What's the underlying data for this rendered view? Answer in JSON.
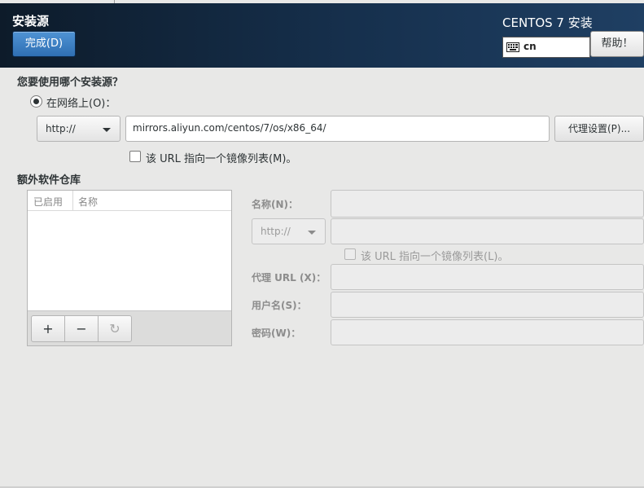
{
  "header": {
    "page_title": "安装源",
    "done_label": "完成(D)",
    "product_title": "CENTOS 7 安装",
    "keyboard_layout": "cn",
    "help_label": "帮助！"
  },
  "source": {
    "question": "您要使用哪个安装源？",
    "network_radio_label": "在网络上(O)：",
    "network_selected": true,
    "protocol": "http://",
    "url": "mirrors.aliyun.com/centos/7/os/x86_64/",
    "proxy_button": "代理设置(P)...",
    "mirror_checkbox_label": "该 URL 指向一个镜像列表(M)。",
    "mirror_checked": false
  },
  "repos": {
    "title": "额外软件仓库",
    "columns": [
      "已启用",
      "名称"
    ],
    "rows": [],
    "add_label": "+",
    "remove_label": "−",
    "refresh_label": "↻"
  },
  "repo_form": {
    "name_label": "名称(N)：",
    "name_value": "",
    "protocol": "http://",
    "url_value": "",
    "mirror_checkbox_label": "该 URL 指向一个镜像列表(L)。",
    "proxy_url_label": "代理 URL (X)：",
    "proxy_url_value": "",
    "username_label": "用户名(S)：",
    "username_value": "",
    "password_label": "密码(W)：",
    "password_value": "",
    "enabled": false
  },
  "colors": {
    "header_bg": "#16304d",
    "accent_button": "#2f6fb3",
    "window_bg": "#e8e8e7"
  }
}
